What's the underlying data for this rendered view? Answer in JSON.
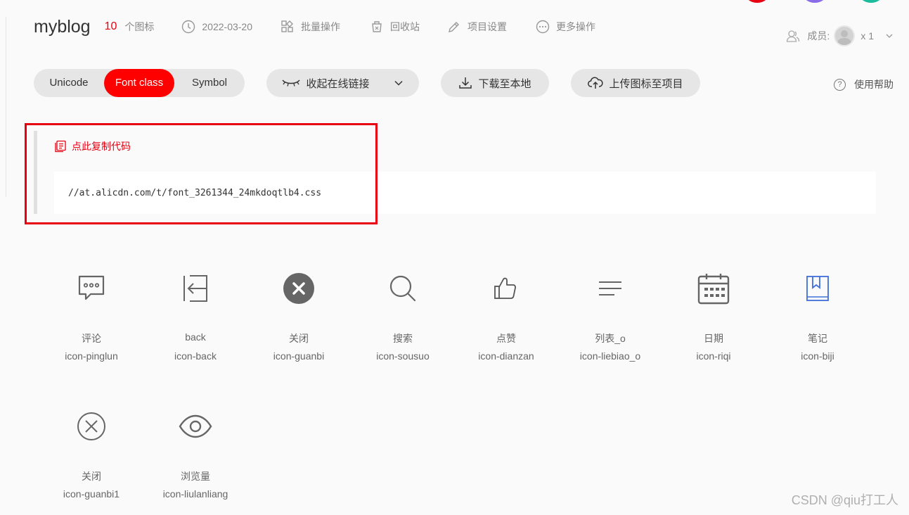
{
  "colors": {
    "accent": "#ff0000",
    "count_red": "#e60012",
    "top_dots": [
      "#e60012",
      "#8a6bea",
      "#1abc9c"
    ]
  },
  "project": {
    "title": "myblog",
    "icon_count": "10",
    "icon_count_label": "个图标"
  },
  "header": {
    "date": {
      "icon": "clock-icon",
      "label": "2022-03-20"
    },
    "batch": {
      "icon": "grid-icon",
      "label": "批量操作"
    },
    "recycle": {
      "icon": "trash-icon",
      "label": "回收站"
    },
    "settings": {
      "icon": "pencil-icon",
      "label": "项目设置"
    },
    "more": {
      "icon": "more-icon",
      "label": "更多操作"
    },
    "members_label": "成员:",
    "members_count": "x 1"
  },
  "toolbar": {
    "tabs": [
      "Unicode",
      "Font class",
      "Symbol"
    ],
    "active_tab": "Font class",
    "collapse_label": "收起在线链接",
    "download_label": "下载至本地",
    "upload_label": "上传图标至项目",
    "help_label": "使用帮助"
  },
  "code": {
    "copy_label": "点此复制代码",
    "url": "//at.alicdn.com/t/font_3261344_24mkdoqtlb4.css"
  },
  "icons": [
    {
      "name": "评论",
      "class": "icon-pinglun",
      "glyph": "comment-icon"
    },
    {
      "name": "back",
      "class": "icon-back",
      "glyph": "back-icon"
    },
    {
      "name": "关闭",
      "class": "icon-guanbi",
      "glyph": "close-filled-icon"
    },
    {
      "name": "搜索",
      "class": "icon-sousuo",
      "glyph": "search-icon"
    },
    {
      "name": "点赞",
      "class": "icon-dianzan",
      "glyph": "thumbs-up-icon"
    },
    {
      "name": "列表_o",
      "class": "icon-liebiao_o",
      "glyph": "list-icon"
    },
    {
      "name": "日期",
      "class": "icon-riqi",
      "glyph": "calendar-icon"
    },
    {
      "name": "笔记",
      "class": "icon-biji",
      "glyph": "notebook-icon"
    },
    {
      "name": "关闭",
      "class": "icon-guanbi1",
      "glyph": "close-outline-icon"
    },
    {
      "name": "浏览量",
      "class": "icon-liulanliang",
      "glyph": "eye-icon"
    }
  ],
  "watermark": "CSDN @qiu打工人"
}
